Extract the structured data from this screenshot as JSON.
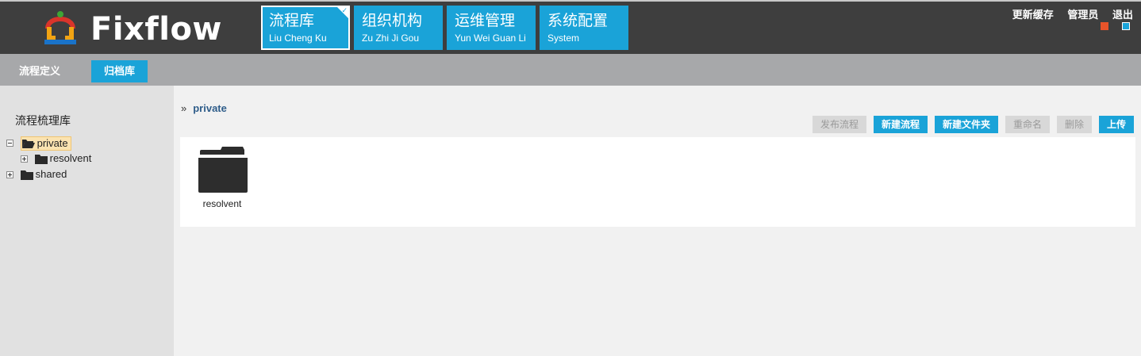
{
  "app": {
    "logo_text": "Fixflow",
    "accent": "#1aa3d8",
    "header_bg": "#3e3e3e"
  },
  "nav_tabs": [
    {
      "zh": "流程库",
      "pinyin": "Liu Cheng Ku",
      "active": true
    },
    {
      "zh": "组织机构",
      "pinyin": "Zu Zhi Ji Gou",
      "active": false
    },
    {
      "zh": "运维管理",
      "pinyin": "Yun Wei Guan Li",
      "active": false
    },
    {
      "zh": "系统配置",
      "pinyin": "System",
      "active": false
    }
  ],
  "top_links": {
    "refresh_cache": "更新缓存",
    "admin": "管理员",
    "logout": "退出"
  },
  "theme_colors": [
    "#e8542a",
    "#1aa3d8"
  ],
  "subnav": {
    "items": [
      {
        "label": "流程定义",
        "active": false
      },
      {
        "label": "归档库",
        "active": true
      }
    ]
  },
  "sidebar": {
    "title": "流程梳理库",
    "tree": [
      {
        "label": "private",
        "expanded": true,
        "selected": true,
        "level": 0
      },
      {
        "label": "resolvent",
        "expanded": false,
        "selected": false,
        "level": 1
      },
      {
        "label": "shared",
        "expanded": false,
        "selected": false,
        "level": 0
      }
    ]
  },
  "breadcrumb": {
    "separator": "»",
    "current": "private"
  },
  "toolbar": {
    "publish": "发布流程",
    "new_process": "新建流程",
    "new_folder": "新建文件夹",
    "rename": "重命名",
    "delete": "删除",
    "upload": "上传"
  },
  "files": [
    {
      "name": "resolvent",
      "icon": "folder-icon"
    }
  ]
}
